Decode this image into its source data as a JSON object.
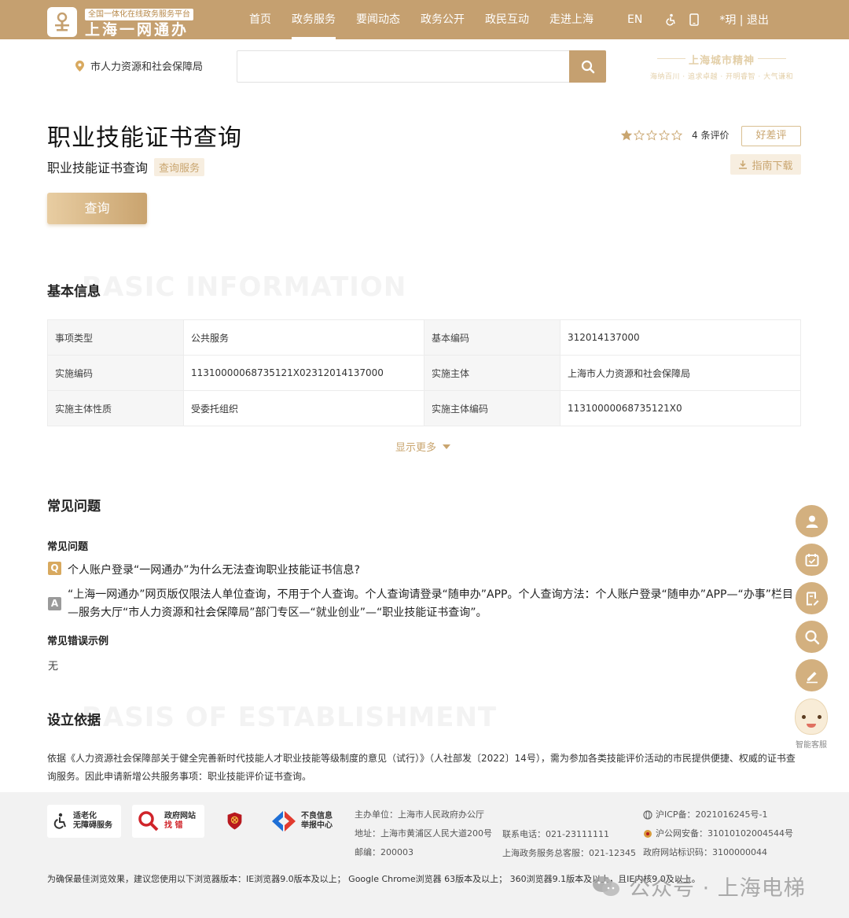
{
  "header": {
    "logo_tag": "全国一体化在线政务服务平台",
    "logo_name": "上海一网通办",
    "nav": [
      "首页",
      "政务服务",
      "要闻动态",
      "政务公开",
      "政民互动",
      "走进上海"
    ],
    "active_nav": "政务服务",
    "lang": "EN",
    "user": "*玥 | 退出"
  },
  "search": {
    "location": "市人力资源和社会保障局",
    "placeholder": "",
    "spirit_title": "上海城市精神",
    "spirit_sub": "海纳百川 · 追求卓越 · 开明睿智 · 大气谦和"
  },
  "service": {
    "title": "职业技能证书查询",
    "subtitle": "职业技能证书查询",
    "type_tag": "查询服务",
    "rating_stars": 1,
    "rating_max": 5,
    "review_count": "4 条评价",
    "rate_button": "好差评",
    "guide_button": "指南下载",
    "query_button": "查询"
  },
  "basic_info": {
    "heading": "基本信息",
    "watermark": "BASIC INFORMATION",
    "rows": [
      [
        "事项类型",
        "公共服务",
        "基本编码",
        "312014137000"
      ],
      [
        "实施编码",
        "11310000068735121X02312014137000",
        "实施主体",
        "上海市人力资源和社会保障局"
      ],
      [
        "实施主体性质",
        "受委托组织",
        "实施主体编码",
        "11310000068735121X0"
      ]
    ],
    "show_more": "显示更多"
  },
  "faq": {
    "heading": "常见问题",
    "sub_heading": "常见问题",
    "q_badge": "Q",
    "a_badge": "A",
    "question": "个人账户登录“一网通办”为什么无法查询职业技能证书信息?",
    "answer": "“上海一网通办”网页版仅限法人单位查询，不用于个人查询。个人查询请登录“随申办”APP。个人查询方法：个人账户登录“随申办”APP—“办事”栏目—服务大厅“市人力资源和社会保障局”部门专区—“就业创业”—“职业技能证书查询”。",
    "errors_heading": "常见错误示例",
    "errors_value": "无"
  },
  "basis": {
    "heading": "设立依据",
    "watermark": "BASIS OF ESTABLISHMENT",
    "text": "依据《人力资源社会保障部关于健全完善新时代技能人才职业技能等级制度的意见（试行）》（人社部发〔2022〕14号），需为参加各类技能评价活动的市民提供便捷、权威的证书查询服务。因此申请新增公共服务事项：职业技能评价证书查询。"
  },
  "footer": {
    "badges": [
      {
        "line1": "适老化",
        "line2": "无障碍服务"
      },
      {
        "line1": "政府网站",
        "line2": "找 错"
      },
      {
        "line1": "",
        "line2": ""
      },
      {
        "line1": "不良信息",
        "line2": "举报中心"
      }
    ],
    "host": "主办单位：上海市人民政府办公厅",
    "address": "地址：上海市黄浦区人民大道200号",
    "postcode": "邮编：200003",
    "phone": "联系电话：021-23111111",
    "hotline": "上海政务服务总客服：021-12345",
    "icp": "沪ICP备：2021016245号-1",
    "police": "沪公网安备：31010102004544号",
    "site_code": "政府网站标识码：3100000044",
    "browser_note": "为确保最佳浏览效果，建议您使用以下浏览器版本：IE浏览器9.0版本及以上； Google Chrome浏览器 63版本及以上； 360浏览器9.1版本及以上，且IE内核9.0及以上。",
    "watermark": "公众号 · 上海电梯"
  },
  "sidebar": {
    "bot_label": "智能客服"
  },
  "colors": {
    "brand": "#c5a070",
    "accent_text": "#c9a56f"
  }
}
